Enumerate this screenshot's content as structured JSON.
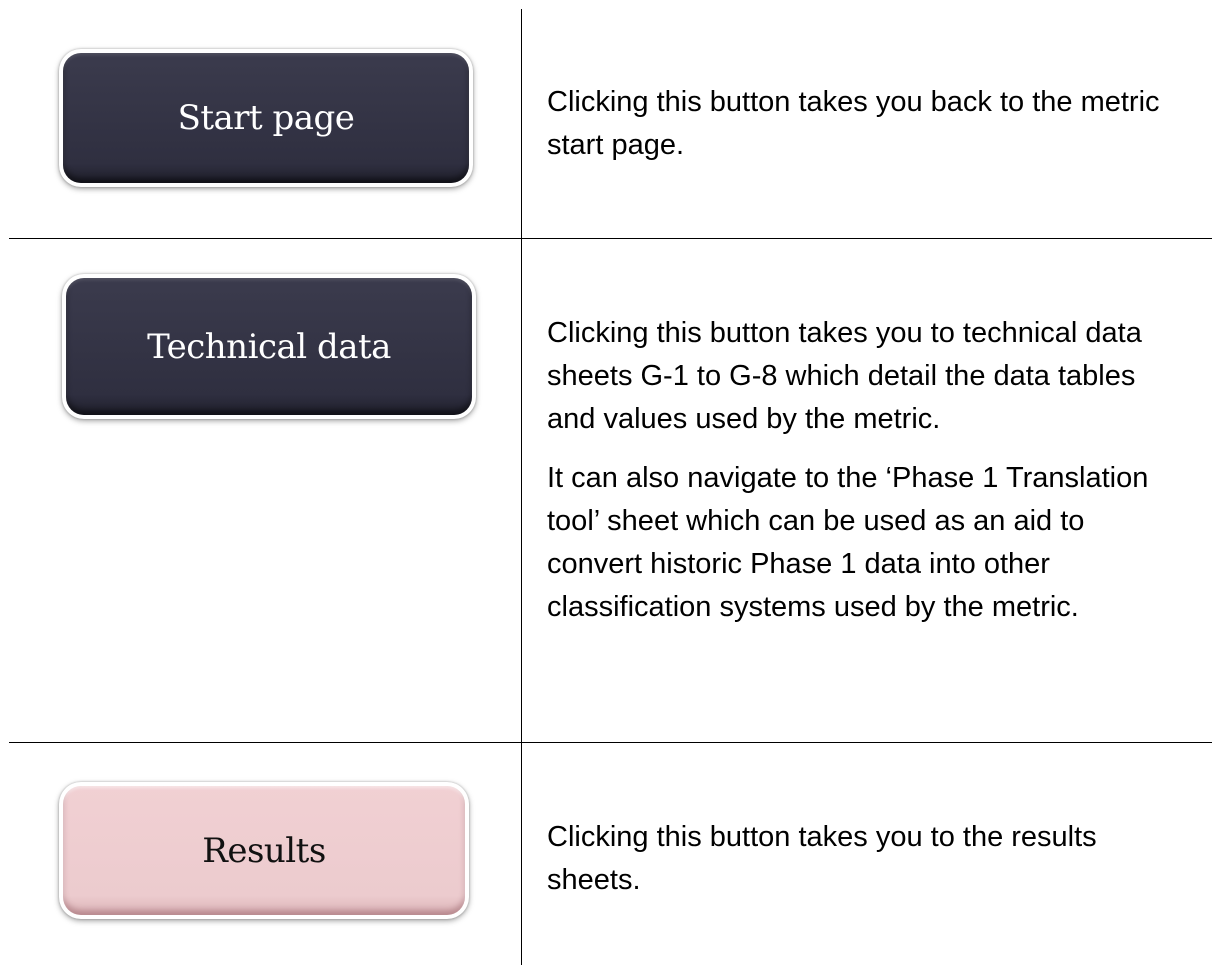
{
  "rows": [
    {
      "button_label": "Start page",
      "paragraphs": [
        "Clicking this button takes you back to the metric start page."
      ]
    },
    {
      "button_label": "Technical data",
      "paragraphs": [
        "Clicking this button takes you to technical data sheets G-1 to G-8 which detail the data tables and values used by the metric.",
        "It can also navigate to the ‘Phase 1 Translation tool’ sheet which can be used as an aid to convert historic Phase 1 data into other classification systems used by the metric."
      ]
    },
    {
      "button_label": "Results",
      "paragraphs": [
        "Clicking this button takes you to the results sheets."
      ]
    }
  ],
  "colors": {
    "dark_button": "#2f2f40",
    "pink_button": "#eccbce"
  }
}
